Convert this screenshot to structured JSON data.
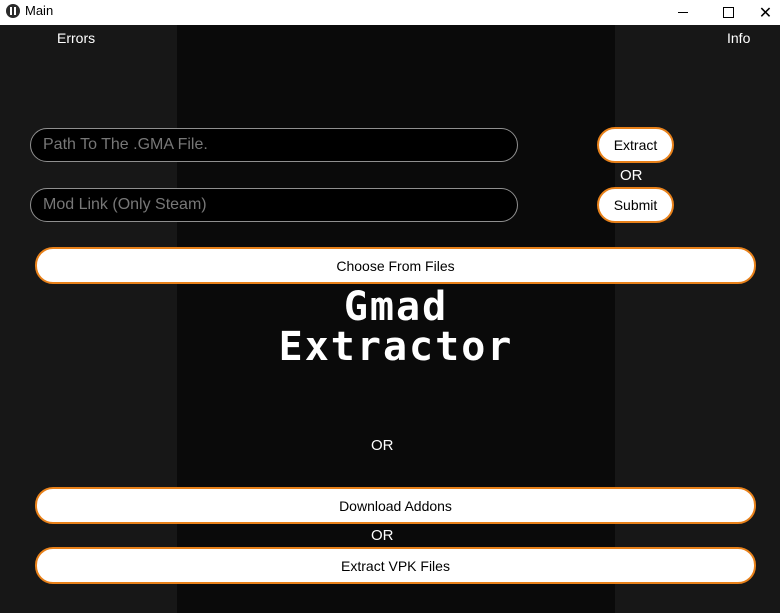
{
  "window": {
    "title": "Main",
    "controls": {
      "minimize": "minimize-icon",
      "maximize": "maximize-icon",
      "close": "close-icon"
    }
  },
  "nav": {
    "errors_label": "Errors",
    "info_label": "Info"
  },
  "inputs": {
    "gma_path_placeholder": "Path To The .GMA File.",
    "mod_link_placeholder": "Mod Link (Only Steam)"
  },
  "buttons": {
    "extract": "Extract",
    "submit": "Submit",
    "choose_files": "Choose From Files",
    "download_addons": "Download Addons",
    "extract_vpk": "Extract VPK Files"
  },
  "separators": {
    "or_1": "OR",
    "or_2": "OR",
    "or_3": "OR"
  },
  "logo": {
    "line1": "Gmad",
    "line2": "Extractor"
  },
  "colors": {
    "background": "#171717",
    "center_panel": "#0a0a0a",
    "accent_border": "#e8811a",
    "button_fill": "#ffffff",
    "text": "#ffffff"
  }
}
